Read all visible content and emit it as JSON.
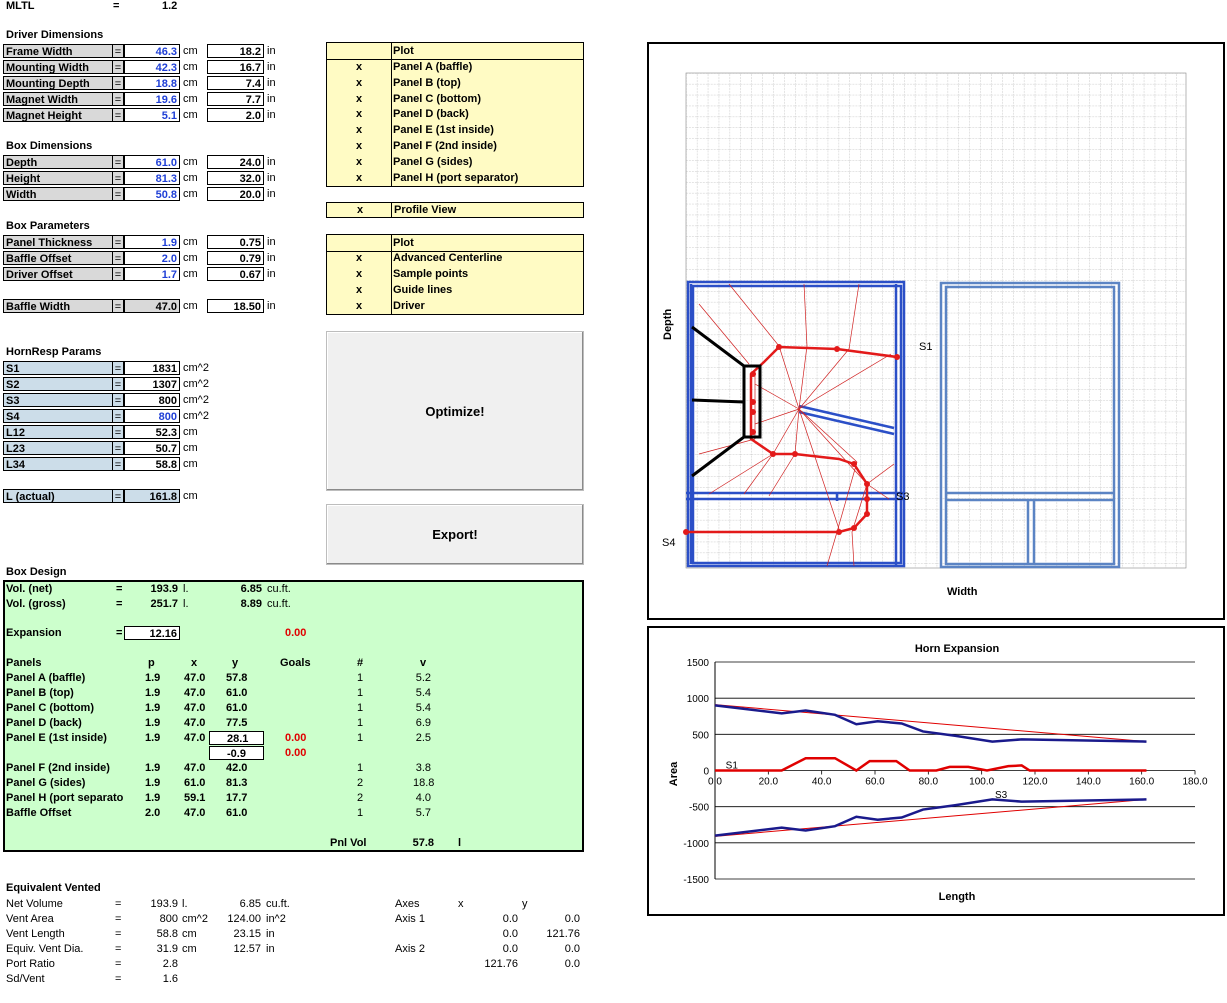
{
  "mltl": {
    "label": "MLTL",
    "eq": "=",
    "value": "1.2"
  },
  "driver": {
    "title": "Driver Dimensions",
    "rows": [
      {
        "label": "Frame Width",
        "cm": "46.3",
        "in": "18.2"
      },
      {
        "label": "Mounting Width",
        "cm": "42.3",
        "in": "16.7"
      },
      {
        "label": "Mounting Depth",
        "cm": "18.8",
        "in": "7.4"
      },
      {
        "label": "Magnet Width",
        "cm": "19.6",
        "in": "7.7"
      },
      {
        "label": "Magnet Height",
        "cm": "5.1",
        "in": "2.0"
      }
    ]
  },
  "box": {
    "title": "Box Dimensions",
    "rows": [
      {
        "label": "Depth",
        "cm": "61.0",
        "in": "24.0"
      },
      {
        "label": "Height",
        "cm": "81.3",
        "in": "32.0"
      },
      {
        "label": "Width",
        "cm": "50.8",
        "in": "20.0"
      }
    ]
  },
  "params": {
    "title": "Box Parameters",
    "rows": [
      {
        "label": "Panel Thickness",
        "cm": "1.9",
        "in": "0.75"
      },
      {
        "label": "Baffle Offset",
        "cm": "2.0",
        "in": "0.79"
      },
      {
        "label": "Driver Offset",
        "cm": "1.7",
        "in": "0.67"
      }
    ],
    "baffle": {
      "label": "Baffle Width",
      "cm": "47.0",
      "in": "18.50"
    }
  },
  "units": {
    "eq": "=",
    "cm": "cm",
    "in": "in",
    "cm2": "cm^2"
  },
  "horn": {
    "title": "HornResp Params",
    "rows": [
      {
        "label": "S1",
        "value": "1831",
        "unit": "cm^2",
        "blue": false
      },
      {
        "label": "S2",
        "value": "1307",
        "unit": "cm^2",
        "blue": false
      },
      {
        "label": "S3",
        "value": "800",
        "unit": "cm^2",
        "blue": false
      },
      {
        "label": "S4",
        "value": "800",
        "unit": "cm^2",
        "blue": true
      },
      {
        "label": "L12",
        "value": "52.3",
        "unit": "cm",
        "blue": false
      },
      {
        "label": "L23",
        "value": "50.7",
        "unit": "cm",
        "blue": false
      },
      {
        "label": "L34",
        "value": "58.8",
        "unit": "cm",
        "blue": false
      }
    ],
    "actual": {
      "label": "L (actual)",
      "value": "161.8",
      "unit": "cm"
    }
  },
  "plot1": {
    "header": "Plot",
    "items": [
      {
        "mark": "x",
        "label": "Panel A (baffle)"
      },
      {
        "mark": "x",
        "label": "Panel B (top)"
      },
      {
        "mark": "x",
        "label": "Panel C (bottom)"
      },
      {
        "mark": "x",
        "label": "Panel D (back)"
      },
      {
        "mark": "x",
        "label": "Panel E (1st inside)"
      },
      {
        "mark": "x",
        "label": "Panel F (2nd inside)"
      },
      {
        "mark": "x",
        "label": "Panel G (sides)"
      },
      {
        "mark": "x",
        "label": "Panel H (port separator)"
      }
    ]
  },
  "profile": {
    "mark": "x",
    "label": "Profile View"
  },
  "plot2": {
    "header": "Plot",
    "items": [
      {
        "mark": "x",
        "label": "Advanced Centerline"
      },
      {
        "mark": "x",
        "label": "Sample points"
      },
      {
        "mark": "x",
        "label": "Guide lines"
      },
      {
        "mark": "x",
        "label": "Driver"
      }
    ]
  },
  "buttons": {
    "optimize": "Optimize!",
    "export": "Export!"
  },
  "design": {
    "title": "Box Design",
    "vol_net": {
      "label": "Vol. (net)",
      "eq": "=",
      "l": "193.9",
      "lu": "l.",
      "cf": "6.85",
      "cfu": "cu.ft."
    },
    "vol_gross": {
      "label": "Vol. (gross)",
      "eq": "=",
      "l": "251.7",
      "lu": "l.",
      "cf": "8.89",
      "cfu": "cu.ft."
    },
    "expansion": {
      "label": "Expansion",
      "eq": "=",
      "value": "12.16",
      "goal": "0.00"
    },
    "headers": {
      "panels": "Panels",
      "p": "p",
      "x": "x",
      "y": "y",
      "goals": "Goals",
      "n": "#",
      "v": "v"
    },
    "panels": [
      {
        "name": "Panel A (baffle)",
        "p": "1.9",
        "x": "47.0",
        "y": "57.8",
        "goal": "",
        "n": "1",
        "v": "5.2"
      },
      {
        "name": "Panel B (top)",
        "p": "1.9",
        "x": "47.0",
        "y": "61.0",
        "goal": "",
        "n": "1",
        "v": "5.4"
      },
      {
        "name": "Panel C (bottom)",
        "p": "1.9",
        "x": "47.0",
        "y": "61.0",
        "goal": "",
        "n": "1",
        "v": "5.4"
      },
      {
        "name": "Panel D (back)",
        "p": "1.9",
        "x": "47.0",
        "y": "77.5",
        "goal": "",
        "n": "1",
        "v": "6.9"
      },
      {
        "name": "Panel E (1st inside)",
        "p": "1.9",
        "x": "47.0",
        "y": "28.1",
        "goal": "0.00",
        "n": "1",
        "v": "2.5"
      },
      {
        "name": "",
        "p": "",
        "x": "",
        "y": "-0.9",
        "goal": "0.00",
        "n": "",
        "v": ""
      },
      {
        "name": "Panel F (2nd inside)",
        "p": "1.9",
        "x": "47.0",
        "y": "42.0",
        "goal": "",
        "n": "1",
        "v": "3.8"
      },
      {
        "name": "Panel G (sides)",
        "p": "1.9",
        "x": "61.0",
        "y": "81.3",
        "goal": "",
        "n": "2",
        "v": "18.8"
      },
      {
        "name": "Panel H (port separato",
        "p": "1.9",
        "x": "59.1",
        "y": "17.7",
        "goal": "",
        "n": "2",
        "v": "4.0"
      },
      {
        "name": "Baffle Offset",
        "p": "2.0",
        "x": "47.0",
        "y": "61.0",
        "goal": "",
        "n": "1",
        "v": "5.7"
      }
    ],
    "pnl_vol": {
      "label": "Pnl Vol",
      "value": "57.8",
      "unit": "l"
    }
  },
  "vented": {
    "title": "Equivalent Vented",
    "rows": [
      {
        "label": "Net Volume",
        "eq": "=",
        "a": "193.9",
        "au": "l.",
        "b": "6.85",
        "bu": "cu.ft."
      },
      {
        "label": "Vent Area",
        "eq": "=",
        "a": "800",
        "au": "cm^2",
        "b": "124.00",
        "bu": "in^2"
      },
      {
        "label": "Vent Length",
        "eq": "=",
        "a": "58.8",
        "au": "cm",
        "b": "23.15",
        "bu": "in"
      },
      {
        "label": "Equiv. Vent Dia.",
        "eq": "=",
        "a": "31.9",
        "au": "cm",
        "b": "12.57",
        "bu": "in"
      },
      {
        "label": "Port Ratio",
        "eq": "=",
        "a": "2.8",
        "au": "",
        "b": "",
        "bu": ""
      },
      {
        "label": "Sd/Vent",
        "eq": "=",
        "a": "1.6",
        "au": "",
        "b": "",
        "bu": ""
      }
    ],
    "axes": {
      "label": "Axes",
      "x": "x",
      "y": "y",
      "rows": [
        {
          "name": "Axis 1",
          "x": "0.0",
          "y": "0.0"
        },
        {
          "name": "",
          "x": "0.0",
          "y": "121.76"
        },
        {
          "name": "Axis 2",
          "x": "0.0",
          "y": "0.0"
        },
        {
          "name": "",
          "x": "121.76",
          "y": "0.0"
        }
      ]
    }
  },
  "profile_chart": {
    "xlabel": "Width",
    "ylabel": "Depth",
    "labels": {
      "s1": "S1",
      "s3": "S3",
      "s4": "S4"
    }
  },
  "chart_data": {
    "type": "line",
    "title": "Horn Expansion",
    "xlabel": "Length",
    "ylabel": "Area",
    "xlim": [
      0,
      180
    ],
    "ylim": [
      -1500,
      1500
    ],
    "xticks": [
      "0.0",
      "20.0",
      "40.0",
      "60.0",
      "80.0",
      "100.0",
      "120.0",
      "140.0",
      "160.0",
      "180.0"
    ],
    "yticks": [
      "1500",
      "1000",
      "500",
      "0",
      "-500",
      "-1000",
      "-1500"
    ],
    "annotations": {
      "s1": "S1",
      "s3": "S3"
    },
    "series": [
      {
        "color": "#1a1a8c",
        "x": [
          0,
          25,
          34,
          45,
          53,
          61,
          70,
          78,
          90,
          104,
          115,
          161.8
        ],
        "y": [
          900,
          790,
          830,
          770,
          640,
          680,
          650,
          540,
          480,
          400,
          430,
          400
        ]
      },
      {
        "color": "#1a1a8c",
        "x": [
          0,
          25,
          34,
          45,
          53,
          61,
          70,
          78,
          90,
          104,
          115,
          161.8
        ],
        "y": [
          -900,
          -790,
          -830,
          -770,
          -640,
          -680,
          -650,
          -540,
          -480,
          -400,
          -430,
          -400
        ]
      },
      {
        "color": "#e00000",
        "x": [
          0,
          25,
          34,
          45,
          53,
          61,
          70,
          78,
          90,
          104,
          115,
          161.8
        ],
        "y": [
          910,
          790,
          790,
          720,
          650,
          650,
          600,
          540,
          490,
          410,
          420,
          400
        ]
      },
      {
        "color": "#e00000",
        "x": [
          0,
          25,
          34,
          45,
          53,
          61,
          70,
          78,
          90,
          104,
          115,
          161.8
        ],
        "y": [
          -910,
          -790,
          -790,
          -720,
          -650,
          -650,
          -600,
          -540,
          -490,
          -410,
          -420,
          -400
        ]
      },
      {
        "color": "#e00000",
        "x": [
          0,
          25,
          34,
          45,
          53,
          58,
          68,
          73,
          83,
          88,
          95,
          102,
          110,
          115,
          118,
          125,
          161.8
        ],
        "y": [
          0,
          0,
          170,
          170,
          0,
          130,
          130,
          0,
          0,
          50,
          50,
          0,
          60,
          70,
          0,
          0,
          0
        ]
      }
    ]
  }
}
